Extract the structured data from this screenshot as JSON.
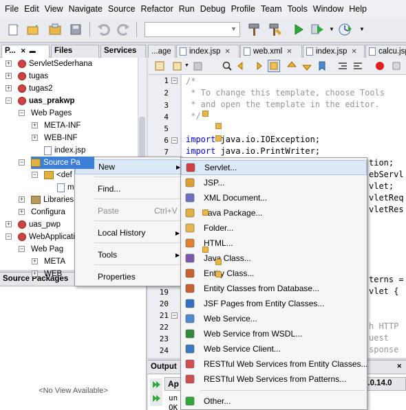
{
  "menubar": [
    "File",
    "Edit",
    "View",
    "Navigate",
    "Source",
    "Refactor",
    "Run",
    "Debug",
    "Profile",
    "Team",
    "Tools",
    "Window",
    "Help"
  ],
  "left_tabs": [
    "P...",
    "Files",
    "Services"
  ],
  "tree": [
    {
      "label": "ServletSederhana",
      "bold": false
    },
    {
      "label": "tugas",
      "bold": false
    },
    {
      "label": "tugas2",
      "bold": false
    },
    {
      "label": "uas_prakwp",
      "bold": true
    },
    {
      "label": "Web Pages",
      "bold": false
    },
    {
      "label": "META-INF",
      "bold": false
    },
    {
      "label": "WEB-INF",
      "bold": false
    },
    {
      "label": "index.jsp",
      "bold": false
    },
    {
      "label": "Source Pa",
      "bold": false
    },
    {
      "label": "<def",
      "bold": false
    },
    {
      "label": "m",
      "bold": false
    },
    {
      "label": "Libraries",
      "bold": false
    },
    {
      "label": "Configura",
      "bold": false
    },
    {
      "label": "uas_pwp",
      "bold": false
    },
    {
      "label": "WebApplicati",
      "bold": false
    },
    {
      "label": "Web Pag",
      "bold": false
    },
    {
      "label": "META",
      "bold": false
    },
    {
      "label": "WEB",
      "bold": false
    }
  ],
  "navigator": {
    "title": "Source Packages",
    "empty_text": "<No View Available>"
  },
  "editor_tabs": [
    "...age",
    "index.jsp",
    "web.xml",
    "index.jsp",
    "calcu.jsp"
  ],
  "line_numbers": [
    "1",
    "2",
    "3",
    "4",
    "5",
    "6",
    "7",
    "8",
    "19",
    "20",
    "21",
    "22",
    "23",
    "24"
  ],
  "code_lines": {
    "l1": "/*",
    "l2": " * To change this template, choose Tools",
    "l3": " * and open the template in the editor.",
    "l4": " */",
    "l6_kw": "import",
    "l6_rest": " java.io.IOException;",
    "l7_kw": "import",
    "l7_rest": " java.io.PrintWriter;",
    "f1": "tion;",
    "f2": "ebServl",
    "f3": "vlet;",
    "f4": "vletReq",
    "f5": "vletRes",
    "f6": "terns =",
    "f7": "vlet {",
    "f8": "h HTTP",
    "f9": "uest",
    "f10": "sponse"
  },
  "output": {
    "title": "Output",
    "fragment1": "Ap",
    "fragment2": "7.0.14.0",
    "fragment3": "un",
    "fragment4": "OK"
  },
  "context_menu": {
    "items": [
      {
        "label": "New",
        "shortcut": "",
        "submenu": true,
        "disabled": false
      },
      {
        "label": "Find...",
        "shortcut": "",
        "submenu": false,
        "disabled": false
      },
      {
        "label": "Paste",
        "shortcut": "Ctrl+V",
        "submenu": false,
        "disabled": true
      },
      {
        "label": "Local History",
        "shortcut": "",
        "submenu": true,
        "disabled": false
      },
      {
        "label": "Tools",
        "shortcut": "",
        "submenu": true,
        "disabled": false
      },
      {
        "label": "Properties",
        "shortcut": "",
        "submenu": false,
        "disabled": false
      }
    ]
  },
  "new_submenu": [
    {
      "label": "Servlet...",
      "icon": "servlet-icon"
    },
    {
      "label": "JSP...",
      "icon": "jsp-icon"
    },
    {
      "label": "XML Document...",
      "icon": "xml-document-icon"
    },
    {
      "label": "Java Package...",
      "icon": "java-package-icon"
    },
    {
      "label": "Folder...",
      "icon": "folder-icon"
    },
    {
      "label": "HTML...",
      "icon": "html-icon"
    },
    {
      "label": "Java Class...",
      "icon": "java-class-icon"
    },
    {
      "label": "Entity Class...",
      "icon": "entity-class-icon"
    },
    {
      "label": "Entity Classes from Database...",
      "icon": "entity-database-icon"
    },
    {
      "label": "JSF Pages from Entity Classes...",
      "icon": "jsf-pages-icon"
    },
    {
      "label": "Web Service...",
      "icon": "web-service-icon"
    },
    {
      "label": "Web Service from WSDL...",
      "icon": "wsdl-icon"
    },
    {
      "label": "Web Service Client...",
      "icon": "web-service-client-icon"
    },
    {
      "label": "RESTful Web Services from Entity Classes...",
      "icon": "restful-entity-icon"
    },
    {
      "label": "RESTful Web Services from Patterns...",
      "icon": "restful-patterns-icon"
    },
    {
      "label": "Other...",
      "icon": "other-icon"
    }
  ]
}
